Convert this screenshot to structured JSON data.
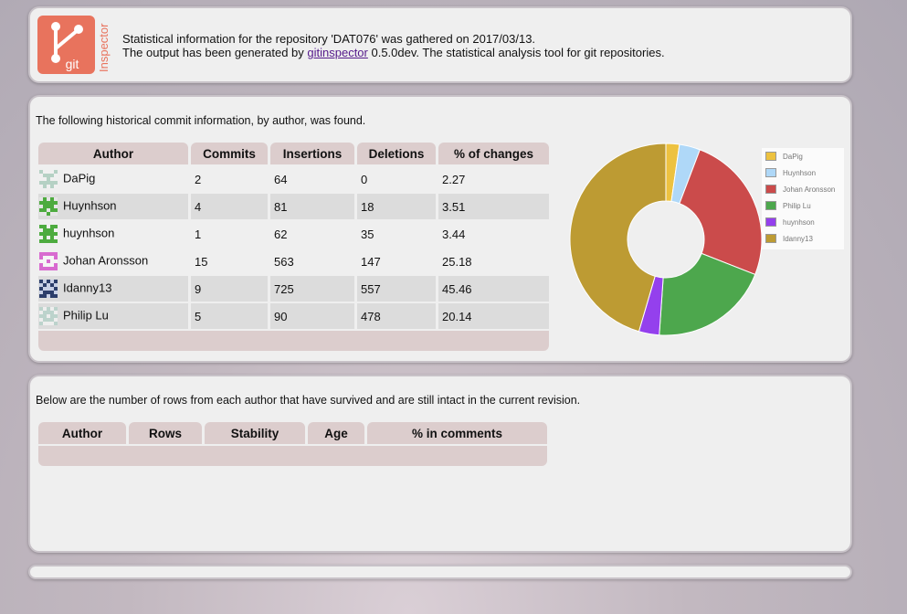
{
  "header": {
    "logo_text_git": "git",
    "logo_text_inspector": "Inspector",
    "line1": "Statistical information for the repository 'DAT076' was gathered on 2017/03/13.",
    "line2_prefix": "The output has been generated by ",
    "link_text": "gitinspector",
    "line2_suffix": " 0.5.0dev. The statistical analysis tool for git repositories."
  },
  "history": {
    "intro": "The following historical commit information, by author, was found.",
    "columns": [
      "Author",
      "Commits",
      "Insertions",
      "Deletions",
      "% of changes"
    ],
    "rows": [
      {
        "author": "DaPig",
        "commits": "2",
        "insertions": "64",
        "deletions": "0",
        "changes": "2.27"
      },
      {
        "author": "Huynhson",
        "commits": "4",
        "insertions": "81",
        "deletions": "18",
        "changes": "3.51"
      },
      {
        "author": "huynhson",
        "commits": "1",
        "insertions": "62",
        "deletions": "35",
        "changes": "3.44"
      },
      {
        "author": "Johan Aronsson",
        "commits": "15",
        "insertions": "563",
        "deletions": "147",
        "changes": "25.18"
      },
      {
        "author": "Idanny13",
        "commits": "9",
        "insertions": "725",
        "deletions": "557",
        "changes": "45.46"
      },
      {
        "author": "Philip Lu",
        "commits": "5",
        "insertions": "90",
        "deletions": "478",
        "changes": "20.14"
      }
    ]
  },
  "blame": {
    "intro": "Below are the number of rows from each author that have survived and are still intact in the current revision.",
    "columns": [
      "Author",
      "Rows",
      "Stability",
      "Age",
      "% in comments"
    ]
  },
  "chart_data": {
    "type": "pie",
    "categories": [
      "DaPig",
      "Huynhson",
      "Johan Aronsson",
      "Philip Lu",
      "huynhson",
      "Idanny13"
    ],
    "values": [
      2.27,
      3.51,
      25.18,
      20.14,
      3.44,
      45.46
    ],
    "colors": [
      "#edc240",
      "#afd8f8",
      "#cb4b4b",
      "#4da74d",
      "#9440ed",
      "#bd9b33"
    ],
    "donut": true,
    "legend": "right"
  }
}
